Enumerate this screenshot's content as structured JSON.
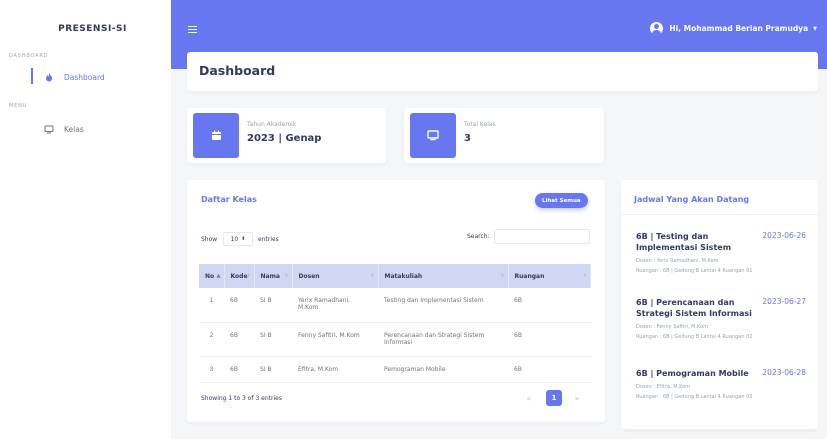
{
  "app": {
    "brand": "PRESENSI-SI"
  },
  "sidebar": {
    "sections": [
      {
        "header": "DASHBOARD",
        "items": [
          {
            "label": "Dashboard",
            "icon": "fire-icon",
            "active": true
          }
        ]
      },
      {
        "header": "MENU",
        "items": [
          {
            "label": "Kelas",
            "icon": "monitor-icon",
            "active": false
          }
        ]
      }
    ]
  },
  "topbar": {
    "user_greeting": "Hi, Mohammad Berian Pramudya"
  },
  "page": {
    "title": "Dashboard"
  },
  "stats": [
    {
      "label": "Tahun Akademik",
      "value": "2023 | Genap",
      "icon": "calendar-icon"
    },
    {
      "label": "Total Kelas",
      "value": "3",
      "icon": "monitor-icon"
    }
  ],
  "kelas": {
    "title": "Daftar Kelas",
    "button": "Lihat Semua",
    "show_label": "Show",
    "entries_value": "10",
    "entries_label": "entries",
    "search_label": "Search:",
    "columns": [
      "No",
      "Kode",
      "Nama",
      "Dosen",
      "Matakuliah",
      "Ruangan"
    ],
    "rows": [
      [
        "1",
        "6B",
        "SI B",
        "Yerix Ramadhani, M.Kom",
        "Testing dan Implementasi Sistem",
        "6B"
      ],
      [
        "2",
        "6B",
        "SI B",
        "Fenny Safitri, M.Kom",
        "Perencanaan dan Strategi Sistem Informasi",
        "6B"
      ],
      [
        "3",
        "6B",
        "SI B",
        "Efitra, M.Kom",
        "Pemograman Mobile",
        "6B"
      ]
    ],
    "info": "Showing 1 to 3 of 3 entries",
    "pagination": {
      "prev": "«",
      "current": "1",
      "next": "»"
    }
  },
  "jadwal": {
    "title": "Jadwal Yang Akan Datang",
    "items": [
      {
        "title": "6B | Testing dan Implementasi Sistem",
        "date": "2023-06-26",
        "dosen": "Dosen : Yerix Ramadhani, M.Kom",
        "ruangan": "Ruangan : 6B | Gedung B Lantai 4 Ruangan 01"
      },
      {
        "title": "6B | Perencanaan dan Strategi Sistem Informasi",
        "date": "2023-06-27",
        "dosen": "Dosen : Fenny Safitri, M.Kom",
        "ruangan": "Ruangan : 6B | Gedung B Lantai 4 Ruangan 02"
      },
      {
        "title": "6B | Pemograman Mobile",
        "date": "2023-06-28",
        "dosen": "Dosen : Efitra, M.Kom",
        "ruangan": "Ruangan : 6B | Gedung B Lantai 4 Ruangan 03"
      }
    ]
  },
  "colors": {
    "primary": "#6777ef",
    "background": "#f4f6f9",
    "table_header": "#cfd7f3"
  }
}
